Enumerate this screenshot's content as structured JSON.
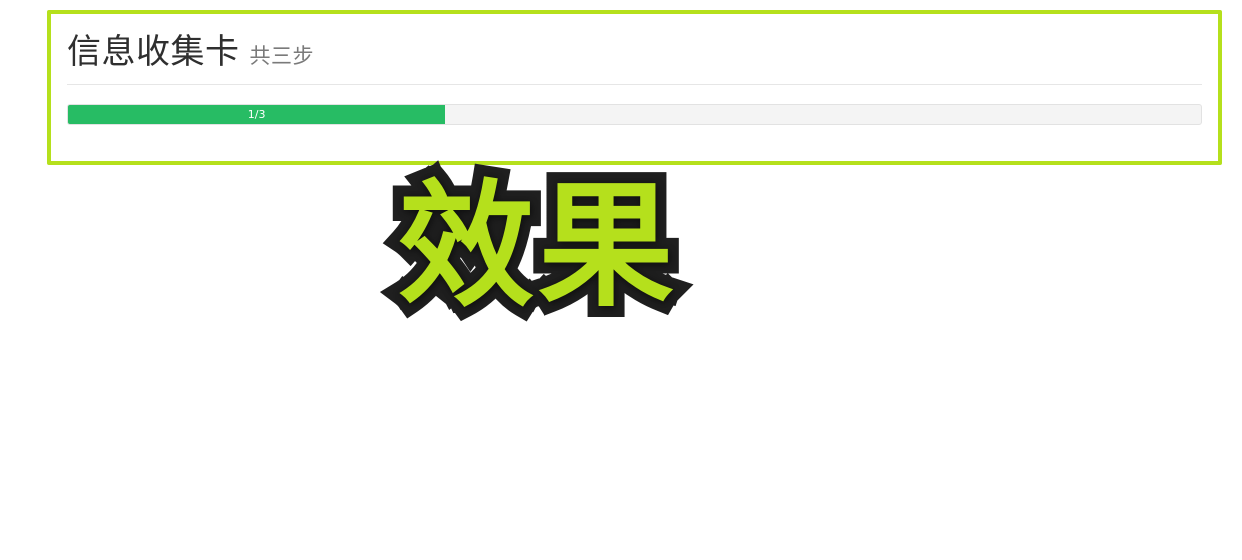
{
  "card": {
    "title": "信息收集卡",
    "subtitle": "共三步",
    "progress": {
      "label": "1/3",
      "fraction": 0.333,
      "fill_color": "#27bc64"
    },
    "outline_color": "#b5e01c"
  },
  "overlay_text": "效果"
}
